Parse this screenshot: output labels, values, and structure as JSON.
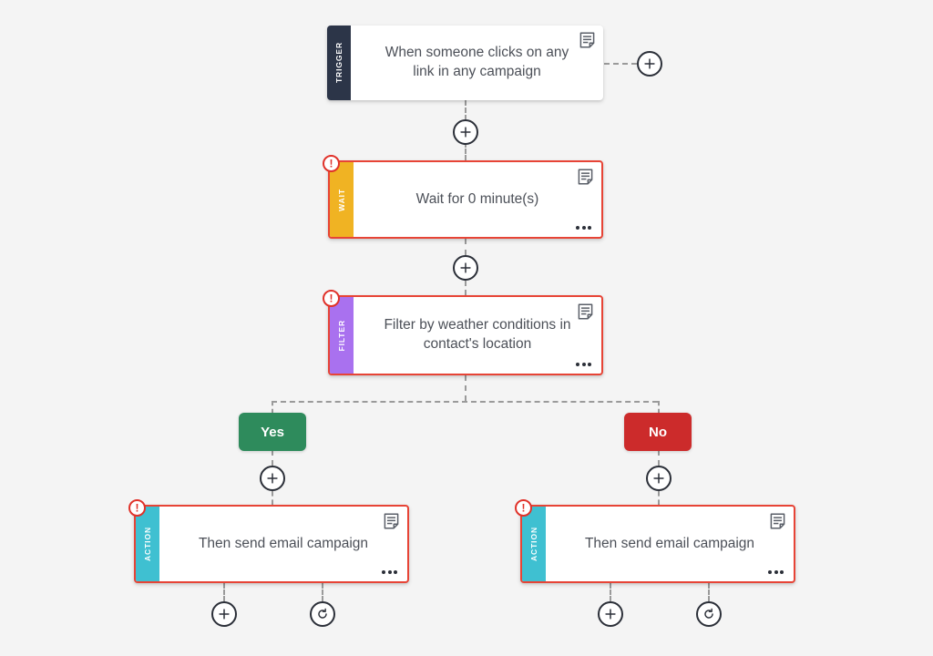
{
  "canvas": {
    "background": "#f4f4f4"
  },
  "colors": {
    "trigger_stripe": "#2c3548",
    "wait_stripe": "#f0b323",
    "filter_stripe": "#a971ef",
    "action_stripe": "#3fc0d1",
    "alert_border": "#e74436",
    "yes_pill": "#2e8b5c",
    "no_pill": "#cc2b2b",
    "connector": "#9a9a9a",
    "badge": "#e0322a"
  },
  "nodes": {
    "trigger": {
      "stripe_label": "TRIGGER",
      "title": "When someone clicks on any link in any campaign",
      "has_alert": false,
      "has_note": true,
      "has_menu": false,
      "note_icon": "note-icon"
    },
    "wait": {
      "stripe_label": "WAIT",
      "title": "Wait for 0 minute(s)",
      "has_alert": true,
      "has_note": true,
      "has_menu": true,
      "note_icon": "note-icon",
      "menu_icon": "ellipsis-icon",
      "alert_icon": "alert-exclamation-icon",
      "alert_glyph": "!"
    },
    "filter": {
      "stripe_label": "FILTER",
      "title": "Filter by weather conditions in contact's location",
      "has_alert": true,
      "has_note": true,
      "has_menu": true,
      "note_icon": "note-icon",
      "menu_icon": "ellipsis-icon",
      "alert_icon": "alert-exclamation-icon",
      "alert_glyph": "!"
    },
    "action_yes": {
      "stripe_label": "ACTION",
      "title": "Then send email campaign",
      "has_alert": true,
      "has_note": true,
      "has_menu": true,
      "note_icon": "note-icon",
      "menu_icon": "ellipsis-icon",
      "alert_icon": "alert-exclamation-icon",
      "alert_glyph": "!"
    },
    "action_no": {
      "stripe_label": "ACTION",
      "title": "Then send email campaign",
      "has_alert": true,
      "has_note": true,
      "has_menu": true,
      "note_icon": "note-icon",
      "menu_icon": "ellipsis-icon",
      "alert_icon": "alert-exclamation-icon",
      "alert_glyph": "!"
    }
  },
  "branches": {
    "yes": {
      "label": "Yes"
    },
    "no": {
      "label": "No"
    }
  },
  "connector_buttons": [
    {
      "id": "add-after-trigger-side",
      "icon": "plus-icon"
    },
    {
      "id": "add-between-trigger-wait",
      "icon": "plus-icon"
    },
    {
      "id": "add-between-wait-filter",
      "icon": "plus-icon"
    },
    {
      "id": "add-after-yes-branch",
      "icon": "plus-icon"
    },
    {
      "id": "add-after-no-branch",
      "icon": "plus-icon"
    },
    {
      "id": "add-after-action-yes",
      "icon": "plus-icon"
    },
    {
      "id": "repeat-action-yes",
      "icon": "refresh-icon"
    },
    {
      "id": "add-after-action-no",
      "icon": "plus-icon"
    },
    {
      "id": "repeat-action-no",
      "icon": "refresh-icon"
    }
  ]
}
